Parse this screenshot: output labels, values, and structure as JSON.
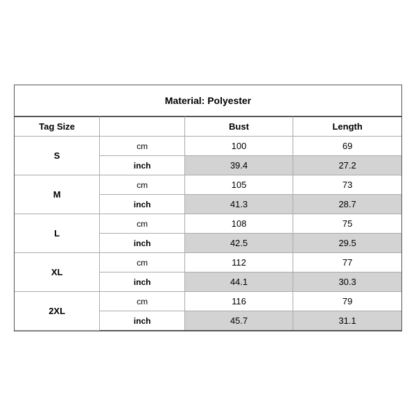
{
  "title": "Material: Polyester",
  "headers": {
    "tag_size": "Tag Size",
    "bust": "Bust",
    "length": "Length"
  },
  "sizes": [
    {
      "tag": "S",
      "cm_bust": "100",
      "cm_length": "69",
      "inch_bust": "39.4",
      "inch_length": "27.2"
    },
    {
      "tag": "M",
      "cm_bust": "105",
      "cm_length": "73",
      "inch_bust": "41.3",
      "inch_length": "28.7"
    },
    {
      "tag": "L",
      "cm_bust": "108",
      "cm_length": "75",
      "inch_bust": "42.5",
      "inch_length": "29.5"
    },
    {
      "tag": "XL",
      "cm_bust": "112",
      "cm_length": "77",
      "inch_bust": "44.1",
      "inch_length": "30.3"
    },
    {
      "tag": "2XL",
      "cm_bust": "116",
      "cm_length": "79",
      "inch_bust": "45.7",
      "inch_length": "31.1"
    }
  ],
  "units": {
    "cm": "cm",
    "inch": "inch"
  },
  "colors": {
    "shaded": "#d3d3d3",
    "border": "#555",
    "inner_border": "#aaa"
  }
}
